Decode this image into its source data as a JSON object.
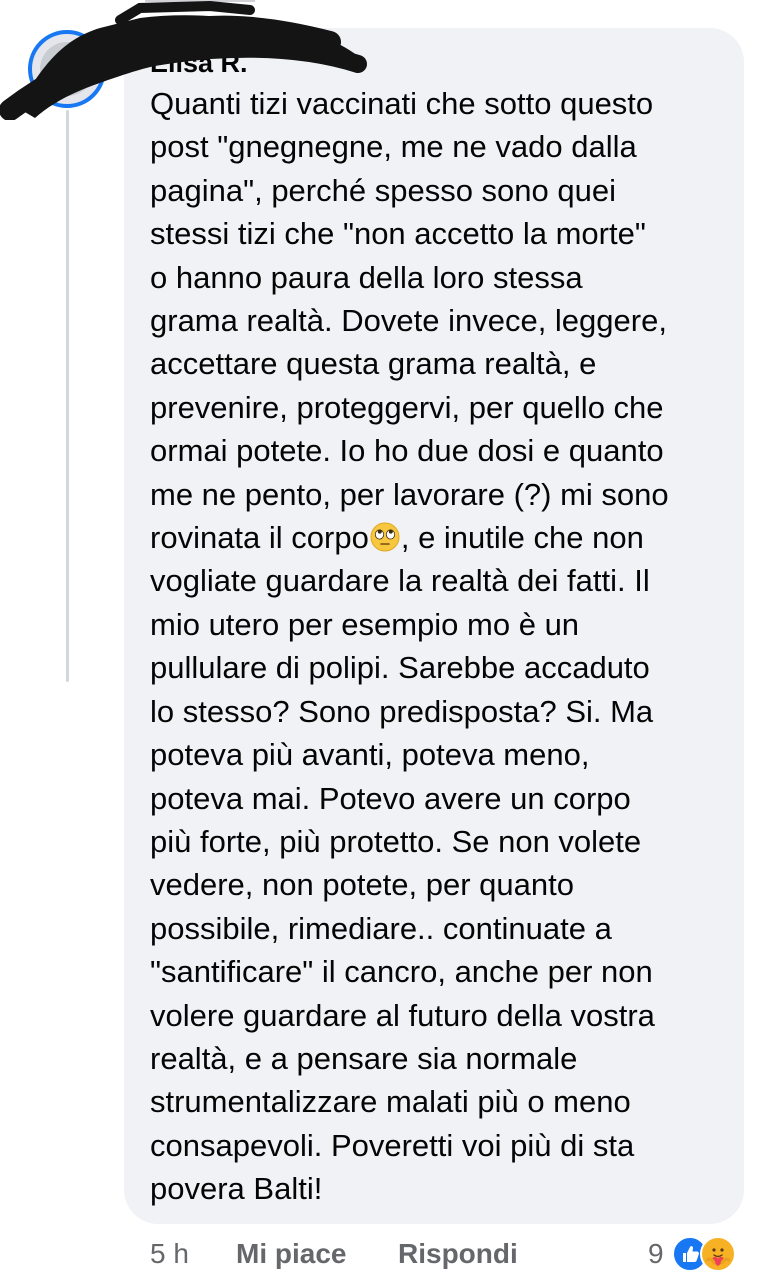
{
  "comment": {
    "author": "Elisa R.",
    "text_part1": "Quanti tizi vaccinati che sotto questo\npost \"gnegnegne, me ne vado dalla\npagina\", perché spesso sono quei\nstessi tizi che \"non accetto la morte\"\no hanno paura della loro stessa\ngrama realtà. Dovete invece, leggere,\naccettare questa grama realtà, e\nprevenire, proteggervi, per quello che\normai potete. Io ho due dosi e quanto\nme ne pento, per lavorare (?) mi sono\nrovinata il corpo",
    "emoji": "face-with-rolling-eyes",
    "text_part2": ", e inutile che non\nvogliate guardare la realtà dei fatti. Il\nmio utero per esempio mo è un\npullulare di polipi. Sarebbe accaduto\nlo stesso? Sono predisposta? Si. Ma\npoteva più avanti, poteva meno,\npoteva mai. Potevo avere un corpo\npiù forte, più protetto. Se non volete\nvedere, non potete, per quanto\npossibile, rimediare.. continuate a\n\"santificare\" il cancro, anche per non\nvolere guardare al futuro della vostra\nrealtà, e a pensare sia normale\nstrumentalizzare malati più o meno\nconsapevoli. Poveretti voi più di sta\npovera Balti!"
  },
  "footer": {
    "timestamp": "5 h",
    "like_label": "Mi piace",
    "reply_label": "Rispondi",
    "reaction_count": "9",
    "reactions": [
      "like-reaction-icon",
      "care-reaction-icon"
    ]
  },
  "colors": {
    "bubble_bg": "#f0f2f5",
    "text": "#050505",
    "secondary_text": "#65676b",
    "facebook_blue": "#1877f2",
    "care_yellow": "#f7b125",
    "thread_line": "#d3d6db"
  }
}
